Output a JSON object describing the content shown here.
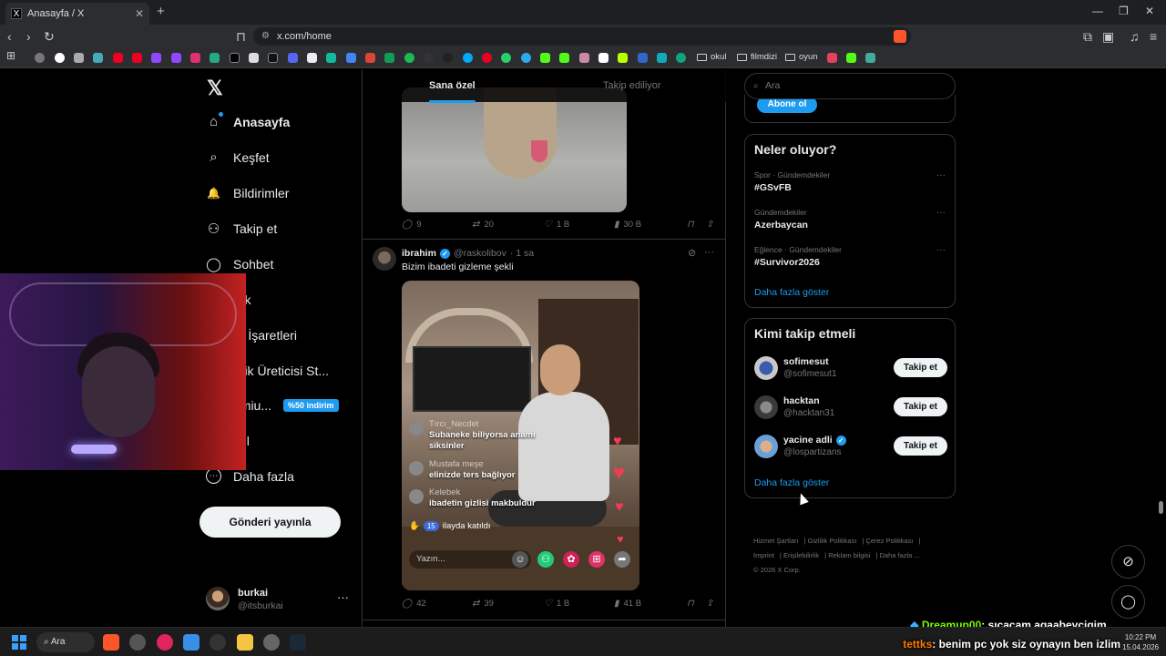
{
  "browser": {
    "tab_title": "Anasayfa / X",
    "tab_close": "✕",
    "new_tab": "+",
    "url": "x.com/home",
    "window_controls": [
      "—",
      "❐",
      "✕"
    ]
  },
  "bookmarks": {
    "folders": [
      "okul",
      "filmdizi",
      "oyun"
    ]
  },
  "left_nav": {
    "logo": "𝕏",
    "items": [
      {
        "label": "Anasayfa",
        "icon": "⌂"
      },
      {
        "label": "Keşfet",
        "icon": "⌕"
      },
      {
        "label": "Bildirimler",
        "icon": "🔔"
      },
      {
        "label": "Takip et",
        "icon": "⚇"
      },
      {
        "label": "Sohbet",
        "icon": "◯"
      },
      {
        "label": "rok",
        "icon": ""
      },
      {
        "label": "er İşaretleri",
        "icon": ""
      },
      {
        "label": "erik Üreticisi St...",
        "icon": ""
      },
      {
        "label": "emiu...",
        "icon": ""
      },
      {
        "label": "ofil",
        "icon": ""
      },
      {
        "label": "Daha fazla",
        "icon": "⋯"
      }
    ],
    "promo_badge": "%50 indirim",
    "post_button": "Gönderi yayınla",
    "user": {
      "name": "burkai",
      "handle": "@itsburkai",
      "more": "···"
    }
  },
  "feed": {
    "tabs": [
      "Sana özel",
      "Takip ediliyor"
    ],
    "post1_actions": {
      "replies": "9",
      "reposts": "20",
      "likes": "1 B",
      "views": "30 B"
    },
    "post2": {
      "name": "ibrahim",
      "handle": "@raskolibov",
      "time": "· 1 sa",
      "text": "Bizim ibadeti gizleme şekli",
      "live_comments": [
        {
          "name": "Tırcı_Necdet",
          "text": "Subaneke biliyorsa anamı"
        },
        {
          "name": "",
          "text": "siksinler"
        },
        {
          "name": "Mustafa meşe",
          "text": "elinizde ters bağlıyor"
        },
        {
          "name": "Kelebek",
          "text": "ibadetin gizlisi makbuldür"
        }
      ],
      "joined_badge": "15",
      "joined_text": "ilayda katıldı",
      "input_placeholder": "Yazın...",
      "actions": {
        "replies": "42",
        "reposts": "39",
        "likes": "1 B",
        "views": "41 B"
      }
    }
  },
  "sidebar": {
    "search_placeholder": "Ara",
    "subscribe_button": "Abone ol",
    "trends_title": "Neler oluyor?",
    "trends": [
      {
        "context": "Spor · Gündemdekiler",
        "title": "#GSvFB"
      },
      {
        "context": "Gündemdekiler",
        "title": "Azerbaycan"
      },
      {
        "context": "Eğlence · Gündemdekiler",
        "title": "#Survivor2026"
      }
    ],
    "trends_more": "Daha fazla göster",
    "wtf_title": "Kimi takip etmeli",
    "who_to_follow": [
      {
        "name": "sofimesut",
        "handle": "@sofimesut1",
        "verified": false,
        "button": "Takip et"
      },
      {
        "name": "hacktan",
        "handle": "@hacktan31",
        "verified": false,
        "button": "Takip et"
      },
      {
        "name": "yacine adli",
        "handle": "@lospartizans",
        "verified": true,
        "button": "Takip et"
      }
    ],
    "wtf_more": "Daha fazla göster",
    "footer": [
      "Hizmet Şartları",
      "Gizlilik Politikası",
      "Çerez Politikası",
      "Imprint",
      "Erişilebilirlik",
      "Reklam bilgisi",
      "Daha fazla ...",
      "© 2026 X Corp."
    ]
  },
  "stream_chat": [
    {
      "user": "Dreamup00",
      "message": ": sıcacam agaabeycigim,",
      "color": "#7CFC00"
    },
    {
      "user": "tettks",
      "message": ": benim pc yok siz oynayın ben izlim",
      "color": "#ff7a00"
    }
  ],
  "taskbar": {
    "search_label": "Ara",
    "time": "10:22 PM",
    "date": "15.04.2026"
  }
}
